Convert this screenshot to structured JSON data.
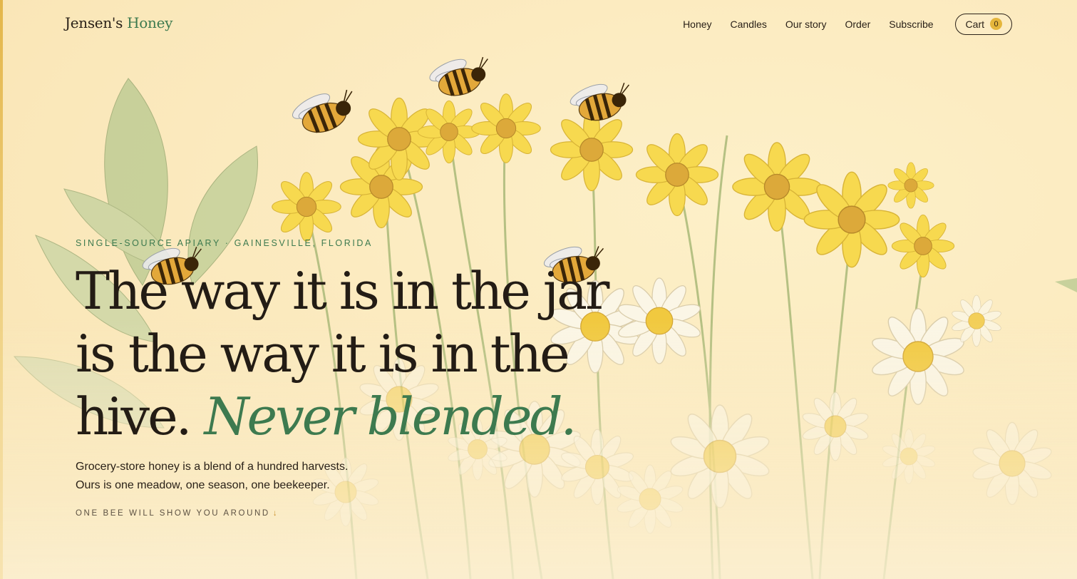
{
  "brand": {
    "name_part1": "Jensen's ",
    "name_part2": "Honey"
  },
  "nav": {
    "items": [
      "Honey",
      "Candles",
      "Our story",
      "Order",
      "Subscribe"
    ],
    "cart_label": "Cart",
    "cart_count": "0"
  },
  "hero": {
    "eyebrow": "SINGLE-SOURCE APIARY · GAINESVILLE, FLORIDA",
    "headline": "The way it is in the jar is the way it is in the hive.",
    "headline_emphasis": "Never blended.",
    "subtext_line1": "Grocery-store honey is a blend of a hundred harvests.",
    "subtext_line2": "Ours is one meadow, one season, one beekeeper.",
    "scroll_cue": "ONE BEE WILL SHOW YOU AROUND",
    "scroll_arrow": "↓"
  },
  "colors": {
    "background": "#fbecc4",
    "accent_green": "#3d7a4f",
    "honey_gold": "#e5b63c",
    "text_dark": "#231c15"
  },
  "icons": {
    "scroll_arrow": "arrow-down-icon"
  }
}
